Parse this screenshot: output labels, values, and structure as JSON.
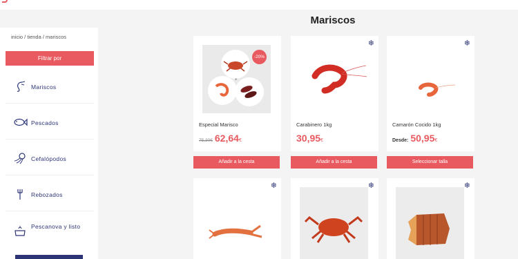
{
  "page": {
    "title": "Mariscos"
  },
  "breadcrumb": "inicio / tienda / mariscos",
  "filter": {
    "label": "Filtrar por"
  },
  "categories": [
    {
      "label": "Mariscos",
      "icon": "shrimp-icon"
    },
    {
      "label": "Pescados",
      "icon": "fish-icon"
    },
    {
      "label": "Cefalópodos",
      "icon": "octopus-icon"
    },
    {
      "label": "Rebozados",
      "icon": "fork-icon"
    },
    {
      "label": "Pescanova y listo",
      "icon": "pot-icon"
    }
  ],
  "products": [
    {
      "name": "Especial Marisco",
      "old_price": "75,30€",
      "price": "62,64",
      "currency": "€",
      "badge": "-20%",
      "button": "Añadir a la cesta",
      "frozen": false
    },
    {
      "name": "Carabinero 1kg",
      "price": "30,95",
      "currency": "€",
      "button": "Añadir a la cesta",
      "frozen": true
    },
    {
      "name": "Camarón Cocido 1kg",
      "prefix": "Desde:",
      "price": "50,95",
      "currency": "€",
      "button": "Seleccionar talla",
      "frozen": true
    },
    {
      "name": "",
      "frozen": true
    },
    {
      "name": "",
      "frozen": true
    },
    {
      "name": "",
      "frozen": true
    }
  ],
  "frozen_symbol": "❄",
  "colors": {
    "accent": "#e85a5f",
    "navy": "#2d3577"
  }
}
